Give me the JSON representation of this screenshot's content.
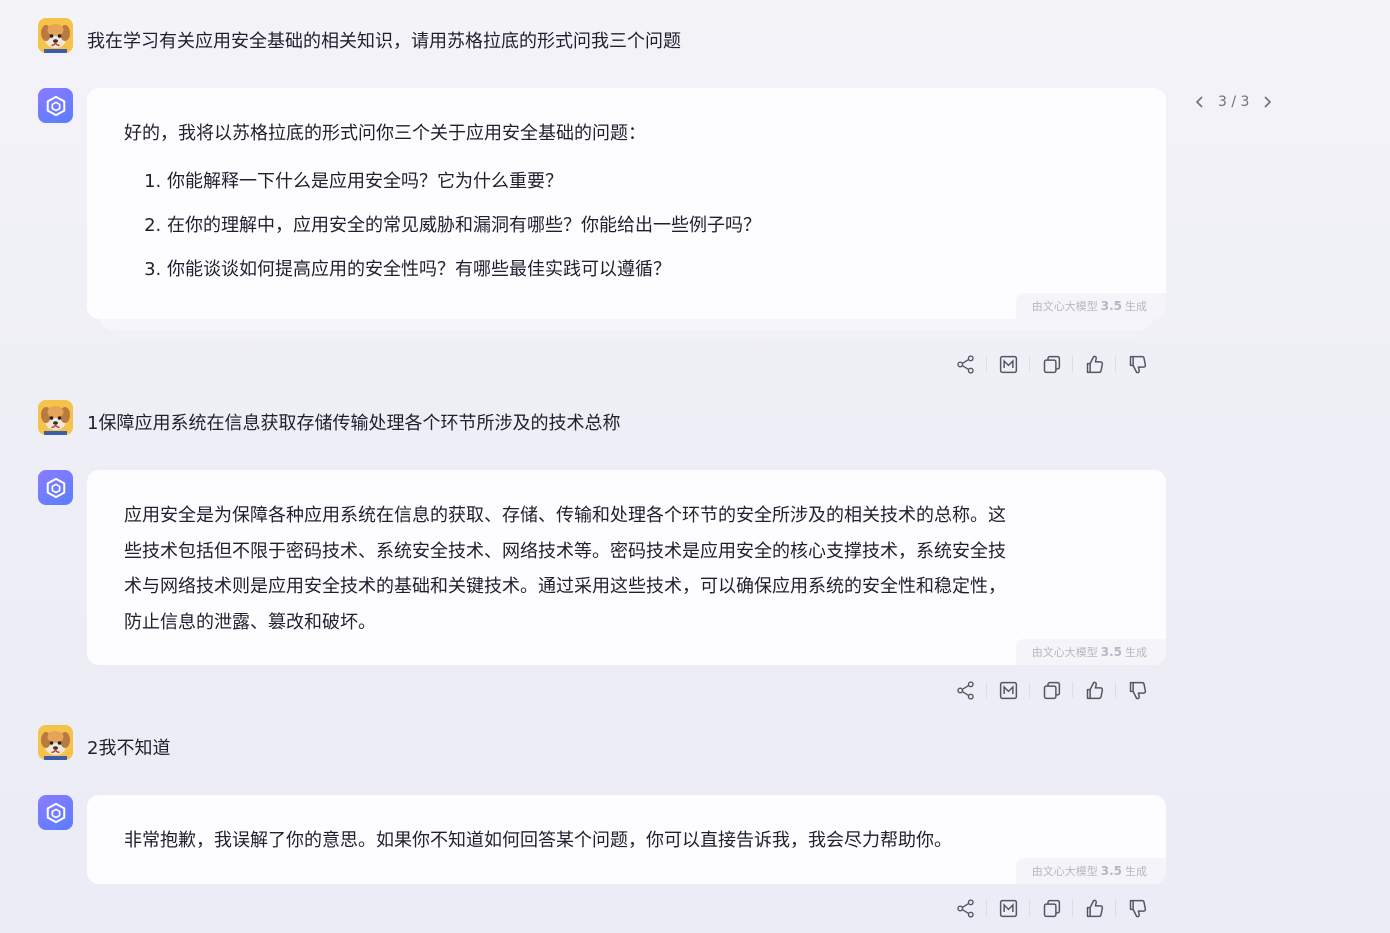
{
  "conversation": [
    {
      "role": "user",
      "text": "我在学习有关应用安全基础的相关知识，请用苏格拉底的形式问我三个问题"
    },
    {
      "role": "assistant",
      "intro": "好的，我将以苏格拉底的形式问你三个关于应用安全基础的问题：",
      "list": [
        "你能解释一下什么是应用安全吗？它为什么重要？",
        "在你的理解中，应用安全的常见威胁和漏洞有哪些？你能给出一些例子吗？",
        "你能谈谈如何提高应用的安全性吗？有哪些最佳实践可以遵循？"
      ],
      "pager": "3 / 3"
    },
    {
      "role": "user",
      "text": "1保障应用系统在信息获取存储传输处理各个环节所涉及的技术总称"
    },
    {
      "role": "assistant",
      "lines": [
        "应用安全是为保障各种应用系统在信息的获取、存储、传输和处理各个环节的安全所涉及的相关技术的总称。这",
        "些技术包括但不限于密码技术、系统安全技术、网络技术等。密码技术是应用安全的核心支撑技术，系统安全技",
        "术与网络技术则是应用安全技术的基础和关键技术。通过采用这些技术，可以确保应用系统的安全性和稳定性，",
        "防止信息的泄露、篡改和破坏。"
      ]
    },
    {
      "role": "user",
      "text": "2我不知道"
    },
    {
      "role": "assistant",
      "text": "非常抱歉，我误解了你的意思。如果你不知道如何回答某个问题，你可以直接告诉我，我会尽力帮助你。"
    }
  ],
  "gen_note": {
    "prefix": "由文心大模型",
    "version": "3.5",
    "suffix": "生成"
  },
  "actions": [
    "share-icon",
    "image-icon",
    "copy-icon",
    "thumbs-up-icon",
    "thumbs-down-icon"
  ],
  "colors": {
    "background": "#f1f1f7",
    "bubble": "#fdfdff",
    "bot_avatar_from": "#8a7cff",
    "bot_avatar_to": "#5a7dff",
    "user_avatar": "#f3b23b"
  }
}
